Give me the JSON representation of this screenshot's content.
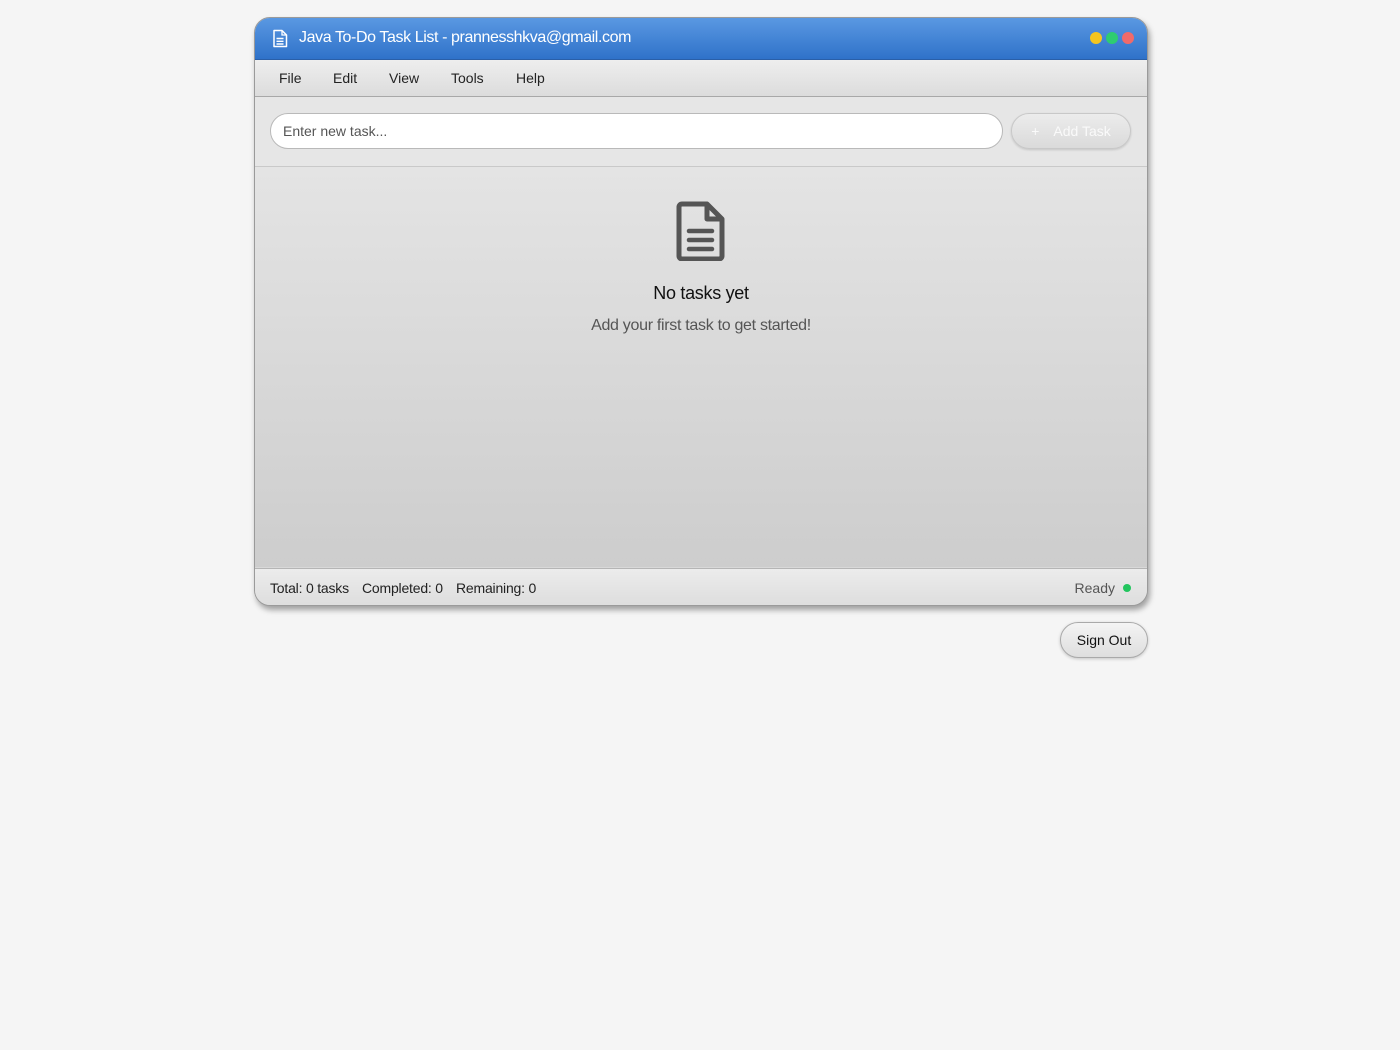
{
  "window": {
    "title": "Java To-Do Task List - prannesshkva@gmail.com",
    "title_icon": "document-icon",
    "controls": [
      {
        "name": "minimize",
        "color": "#f4c51f"
      },
      {
        "name": "maximize",
        "color": "#2ecc71"
      },
      {
        "name": "close",
        "color": "#f06a6a"
      }
    ]
  },
  "menu": {
    "items": [
      "File",
      "Edit",
      "View",
      "Tools",
      "Help"
    ]
  },
  "input": {
    "value": "",
    "placeholder": "Enter new task...",
    "add_button_icon": "+",
    "add_button_label": "Add Task"
  },
  "empty_state": {
    "icon": "document-icon",
    "title": "No tasks yet",
    "subtitle": "Add your first task to get started!"
  },
  "status": {
    "total": "Total: 0 tasks",
    "completed": "Completed: 0",
    "remaining": "Remaining: 0",
    "state": "Ready",
    "state_color": "#22c55e"
  },
  "footer": {
    "sign_out_label": "Sign Out"
  },
  "colors": {
    "titlebar_accent": "#3a7fd6",
    "page_background": "#f5f5f5"
  }
}
